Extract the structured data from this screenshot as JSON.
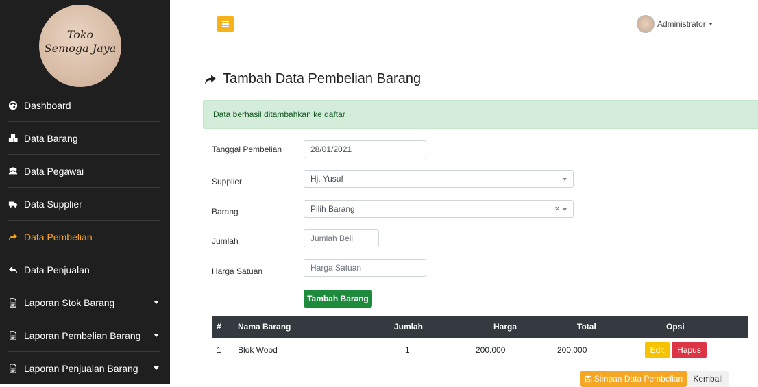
{
  "brand": {
    "line1": "Toko",
    "line2": "Semoga Jaya"
  },
  "sidebar": {
    "items": [
      {
        "label": "Dashboard",
        "icon": "palette-icon"
      },
      {
        "label": "Data Barang",
        "icon": "cubes-icon"
      },
      {
        "label": "Data Pegawai",
        "icon": "users-icon"
      },
      {
        "label": "Data Supplier",
        "icon": "truck-icon"
      },
      {
        "label": "Data Pembelian",
        "icon": "share-icon",
        "active": true
      },
      {
        "label": "Data Penjualan",
        "icon": "reply-icon"
      },
      {
        "label": "Laporan Stok Barang",
        "icon": "file-icon"
      },
      {
        "label": "Laporan Pembelian Barang",
        "icon": "file-icon"
      },
      {
        "label": "Laporan Penjualan Barang",
        "icon": "file-icon"
      }
    ]
  },
  "topbar": {
    "user": "Administrator"
  },
  "page": {
    "title": "Tambah Data Pembelian Barang"
  },
  "alert": {
    "message": "Data berhasil ditambahkan ke daftar"
  },
  "form": {
    "tanggal": {
      "label": "Tanggal Pembelian",
      "value": "28/01/2021"
    },
    "supplier": {
      "label": "Supplier",
      "value": "Hj. Yusuf"
    },
    "barang": {
      "label": "Barang",
      "value": "Pilih Barang",
      "clear": "×"
    },
    "jumlah": {
      "label": "Jumlah",
      "placeholder": "Jumlah Beli"
    },
    "harga": {
      "label": "Harga Satuan",
      "placeholder": "Harga Satuan"
    },
    "add_button": "Tambah Barang"
  },
  "table": {
    "headers": {
      "no": "#",
      "nama": "Nama Barang",
      "jumlah": "Jumlah",
      "harga": "Harga",
      "total": "Total",
      "opsi": "Opsi"
    },
    "rows": [
      {
        "no": "1",
        "nama": "Blok Wood",
        "jumlah": "1",
        "harga": "200.000",
        "total": "200.000",
        "edit": "Edit",
        "hapus": "Hapus"
      }
    ]
  },
  "actions": {
    "save": "Simpan Data Pembelian",
    "back": "Kembali"
  },
  "colors": {
    "sidebar": "#1f1f1f",
    "accent": "#f5a623",
    "success": "#1e8a3c",
    "danger": "#dc3545",
    "header": "#343a40"
  }
}
